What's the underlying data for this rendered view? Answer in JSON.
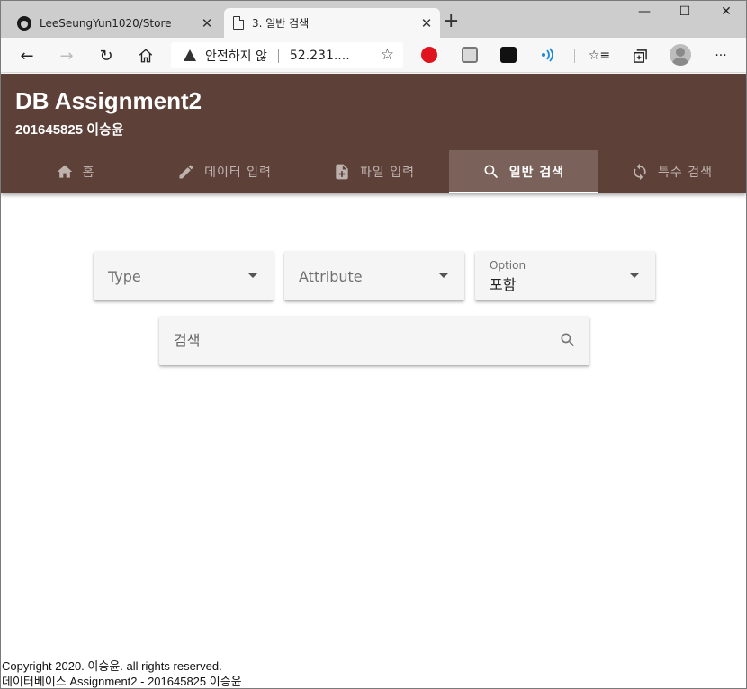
{
  "browser": {
    "tabs": [
      {
        "title": "LeeSeungYun1020/Store",
        "icon": "github-icon",
        "active": false
      },
      {
        "title": "3. 일반 검색",
        "icon": "page-icon",
        "active": true
      }
    ],
    "close_glyph": "✕",
    "new_tab_glyph": "+",
    "window_controls": {
      "minimize": "—",
      "maximize": "☐",
      "close": "✕"
    },
    "nav": {
      "back": "←",
      "forward": "→",
      "refresh": "↻"
    },
    "security_text": "안전하지 않",
    "url": "52.231....",
    "star_glyph": "☆",
    "favorites_glyph": "☆≡",
    "more_glyph": "···"
  },
  "app": {
    "title": "DB Assignment2",
    "subtitle": "201645825 이승윤",
    "accent_color": "#5d4037",
    "tabs": [
      {
        "label": "홈",
        "icon": "home-icon",
        "active": false
      },
      {
        "label": "데이터 입력",
        "icon": "pencil-icon",
        "active": false
      },
      {
        "label": "파일 입력",
        "icon": "file-add-icon",
        "active": false
      },
      {
        "label": "일반 검색",
        "icon": "search-icon",
        "active": true
      },
      {
        "label": "특수 검색",
        "icon": "sync-icon",
        "active": false
      }
    ]
  },
  "form": {
    "type_select": {
      "label": "Type",
      "value": ""
    },
    "attribute_select": {
      "label": "Attribute",
      "value": ""
    },
    "option_select": {
      "label": "Option",
      "value": "포함"
    },
    "search": {
      "placeholder": "검색",
      "value": ""
    }
  },
  "footer": {
    "copyright": "Copyright 2020. 이승윤. all rights reserved.",
    "course": "데이터베이스 Assignment2 - 201645825 이승윤"
  }
}
